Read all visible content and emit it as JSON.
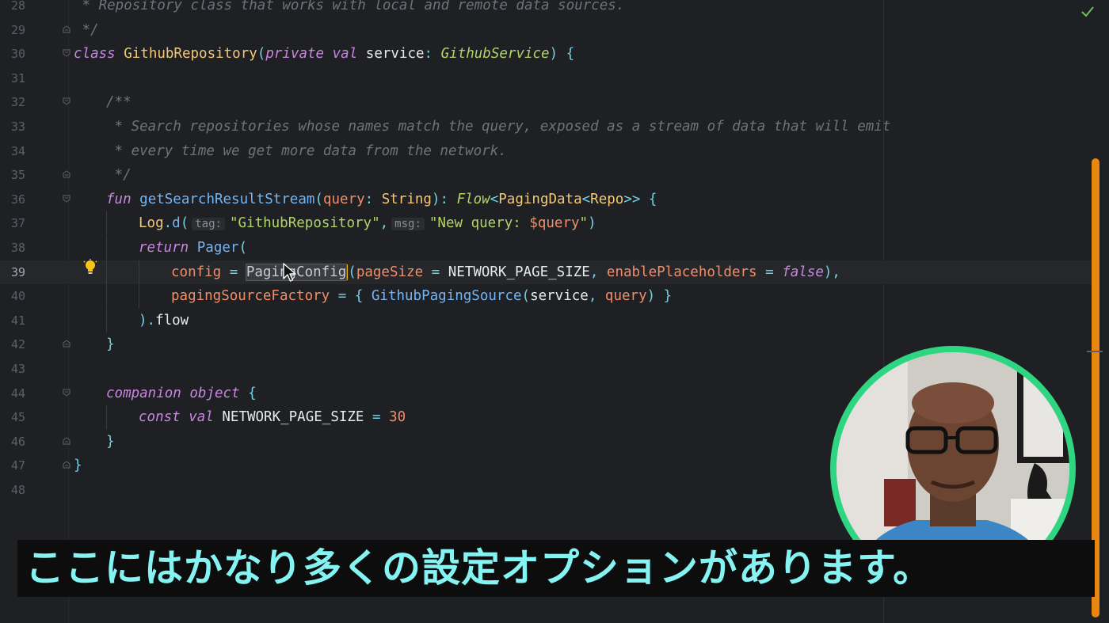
{
  "editor": {
    "lines": [
      {
        "num": "28",
        "indent": 0,
        "tokens": [
          {
            "t": " * Repository class that works with local and remote data sources.",
            "c": "cm"
          }
        ]
      },
      {
        "num": "29",
        "indent": 0,
        "fold": "end",
        "tokens": [
          {
            "t": " */",
            "c": "cm"
          }
        ]
      },
      {
        "num": "30",
        "indent": 0,
        "fold": "start",
        "tokens": [
          {
            "t": "class ",
            "c": "kw"
          },
          {
            "t": "GithubRepository",
            "c": "cls"
          },
          {
            "t": "(",
            "c": "punc"
          },
          {
            "t": "private val ",
            "c": "kw"
          },
          {
            "t": "service",
            "c": "id"
          },
          {
            "t": ": ",
            "c": "punc"
          },
          {
            "t": "GithubService",
            "c": "tyi"
          },
          {
            "t": ") {",
            "c": "punc"
          }
        ]
      },
      {
        "num": "31",
        "indent": 0,
        "tokens": []
      },
      {
        "num": "32",
        "indent": 1,
        "fold": "start",
        "tokens": [
          {
            "t": "/**",
            "c": "cm"
          }
        ]
      },
      {
        "num": "33",
        "indent": 1,
        "tokens": [
          {
            "t": " * Search repositories whose names match the query, exposed as a stream of data that will emit",
            "c": "cm"
          }
        ]
      },
      {
        "num": "34",
        "indent": 1,
        "tokens": [
          {
            "t": " * every time we get more data from the network.",
            "c": "cm"
          }
        ]
      },
      {
        "num": "35",
        "indent": 1,
        "fold": "end",
        "tokens": [
          {
            "t": " */",
            "c": "cm"
          }
        ]
      },
      {
        "num": "36",
        "indent": 1,
        "fold": "start",
        "tokens": [
          {
            "t": "fun ",
            "c": "kw"
          },
          {
            "t": "getSearchResultStream",
            "c": "fn"
          },
          {
            "t": "(",
            "c": "punc"
          },
          {
            "t": "query",
            "c": "param"
          },
          {
            "t": ": ",
            "c": "punc"
          },
          {
            "t": "String",
            "c": "ty"
          },
          {
            "t": "): ",
            "c": "punc"
          },
          {
            "t": "Flow",
            "c": "tyi"
          },
          {
            "t": "<",
            "c": "punc"
          },
          {
            "t": "PagingData",
            "c": "ty"
          },
          {
            "t": "<",
            "c": "punc"
          },
          {
            "t": "Repo",
            "c": "ty"
          },
          {
            "t": ">> {",
            "c": "punc"
          }
        ]
      },
      {
        "num": "37",
        "indent": 2,
        "tokens": [
          {
            "t": "Log",
            "c": "cls"
          },
          {
            "t": ".",
            "c": "punc"
          },
          {
            "t": "d",
            "c": "fn"
          },
          {
            "t": "(",
            "c": "punc"
          },
          {
            "t": "tag:",
            "c": "hint"
          },
          {
            "t": "\"GithubRepository\"",
            "c": "str"
          },
          {
            "t": ",",
            "c": "punc"
          },
          {
            "t": "msg:",
            "c": "hint"
          },
          {
            "t": "\"New query: ",
            "c": "str"
          },
          {
            "t": "$query",
            "c": "param"
          },
          {
            "t": "\"",
            "c": "str"
          },
          {
            "t": ")",
            "c": "punc"
          }
        ]
      },
      {
        "num": "38",
        "indent": 2,
        "tokens": [
          {
            "t": "return ",
            "c": "kw"
          },
          {
            "t": "Pager",
            "c": "fn"
          },
          {
            "t": "(",
            "c": "punc"
          }
        ]
      },
      {
        "num": "39",
        "indent": 3,
        "current": true,
        "tokens": [
          {
            "t": "config",
            "c": "param"
          },
          {
            "t": " = ",
            "c": "punc"
          },
          {
            "t": "PagingConfig",
            "c": "sel"
          },
          {
            "t": "",
            "c": "caret"
          },
          {
            "t": "(",
            "c": "punc"
          },
          {
            "t": "pageSize",
            "c": "param"
          },
          {
            "t": " = ",
            "c": "punc"
          },
          {
            "t": "NETWORK_PAGE_SIZE",
            "c": "id"
          },
          {
            "t": ", ",
            "c": "punc"
          },
          {
            "t": "enablePlaceholders",
            "c": "param"
          },
          {
            "t": " = ",
            "c": "punc"
          },
          {
            "t": "false",
            "c": "kw"
          },
          {
            "t": "),",
            "c": "punc"
          }
        ]
      },
      {
        "num": "40",
        "indent": 3,
        "tokens": [
          {
            "t": "pagingSourceFactory",
            "c": "param"
          },
          {
            "t": " = { ",
            "c": "punc"
          },
          {
            "t": "GithubPagingSource",
            "c": "fn"
          },
          {
            "t": "(",
            "c": "punc"
          },
          {
            "t": "service",
            "c": "id"
          },
          {
            "t": ", ",
            "c": "punc"
          },
          {
            "t": "query",
            "c": "param"
          },
          {
            "t": ") }",
            "c": "punc"
          }
        ]
      },
      {
        "num": "41",
        "indent": 2,
        "tokens": [
          {
            "t": ").",
            "c": "punc"
          },
          {
            "t": "flow",
            "c": "id"
          }
        ]
      },
      {
        "num": "42",
        "indent": 1,
        "fold": "end",
        "tokens": [
          {
            "t": "}",
            "c": "punc"
          }
        ]
      },
      {
        "num": "43",
        "indent": 0,
        "tokens": []
      },
      {
        "num": "44",
        "indent": 1,
        "fold": "start",
        "tokens": [
          {
            "t": "companion object ",
            "c": "kw"
          },
          {
            "t": "{",
            "c": "punc"
          }
        ]
      },
      {
        "num": "45",
        "indent": 2,
        "tokens": [
          {
            "t": "const val ",
            "c": "kw"
          },
          {
            "t": "NETWORK_PAGE_SIZE",
            "c": "id"
          },
          {
            "t": " = ",
            "c": "punc"
          },
          {
            "t": "30",
            "c": "num"
          }
        ]
      },
      {
        "num": "46",
        "indent": 1,
        "fold": "end",
        "tokens": [
          {
            "t": "}",
            "c": "punc"
          }
        ]
      },
      {
        "num": "47",
        "indent": 0,
        "fold": "end",
        "tokens": [
          {
            "t": "}",
            "c": "punc"
          }
        ]
      },
      {
        "num": "48",
        "indent": 0,
        "tokens": []
      }
    ]
  },
  "subtitle": {
    "text": "ここにはかなり多くの設定オプションがあります。"
  },
  "colors": {
    "scrollbar_thumb": "#e8860f",
    "webcam_ring": "#2ed681",
    "subtitle_text": "#86f3f3"
  },
  "icons": {
    "status": "check-icon",
    "intention": "lightbulb-icon",
    "pointer": "mouse-cursor-icon"
  }
}
